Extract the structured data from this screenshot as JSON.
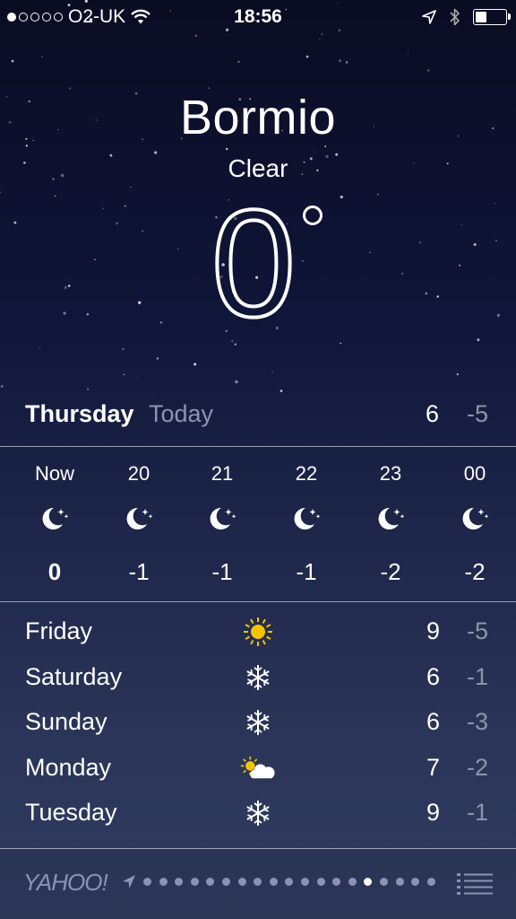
{
  "status": {
    "carrier": "O2-UK",
    "time": "18:56",
    "signal_filled": 1,
    "signal_total": 5
  },
  "location": {
    "city": "Bormio",
    "condition": "Clear",
    "temperature": "0",
    "degree": "°"
  },
  "today": {
    "day": "Thursday",
    "label": "Today",
    "high": "6",
    "low": "-5"
  },
  "hourly": [
    {
      "time": "Now",
      "icon": "moon-stars-icon",
      "temp": "0"
    },
    {
      "time": "20",
      "icon": "moon-stars-icon",
      "temp": "-1"
    },
    {
      "time": "21",
      "icon": "moon-stars-icon",
      "temp": "-1"
    },
    {
      "time": "22",
      "icon": "moon-stars-icon",
      "temp": "-1"
    },
    {
      "time": "23",
      "icon": "moon-stars-icon",
      "temp": "-2"
    },
    {
      "time": "00",
      "icon": "moon-stars-icon",
      "temp": "-2"
    }
  ],
  "daily": [
    {
      "day": "Friday",
      "icon": "sun-icon",
      "high": "9",
      "low": "-5"
    },
    {
      "day": "Saturday",
      "icon": "snowflake-icon",
      "high": "6",
      "low": "-1"
    },
    {
      "day": "Sunday",
      "icon": "snowflake-icon",
      "high": "6",
      "low": "-3"
    },
    {
      "day": "Monday",
      "icon": "partly-cloudy-icon",
      "high": "7",
      "low": "-2"
    },
    {
      "day": "Tuesday",
      "icon": "snowflake-icon",
      "high": "9",
      "low": "-1"
    }
  ],
  "footer": {
    "brand": "YAHOO!",
    "page_count": 19,
    "active_page": 14
  },
  "colors": {
    "sun": "#f5c400",
    "muted": "#8e94ab"
  }
}
